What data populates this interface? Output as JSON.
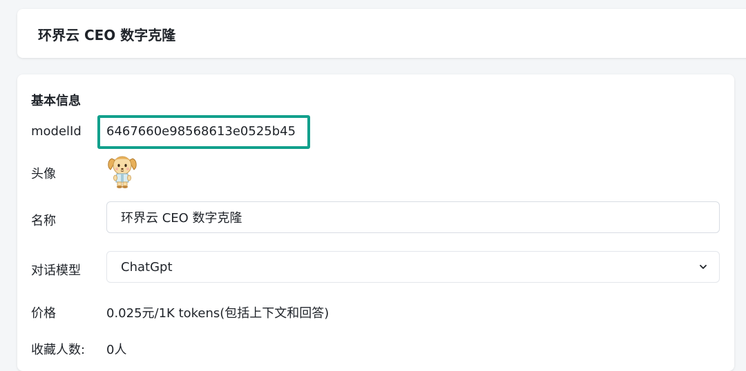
{
  "header": {
    "title": "环界云 CEO 数字克隆"
  },
  "basic_info": {
    "section_title": "基本信息",
    "model_id_label": "modelId",
    "model_id_value": "6467660e98568613e0525b45",
    "avatar_label": "头像",
    "name_label": "名称",
    "name_value": "环界云 CEO 数字克隆",
    "chat_model_label": "对话模型",
    "chat_model_value": "ChatGpt",
    "price_label": "价格",
    "price_value": "0.025元/1K tokens(包括上下文和回答)",
    "favorites_label": "收藏人数:",
    "favorites_value": "0人"
  },
  "colors": {
    "highlight_border": "#12a08c",
    "background": "#f4f6f8"
  },
  "icons": {
    "avatar": "puppy-avatar-icon",
    "select_arrow": "chevron-down-icon"
  }
}
